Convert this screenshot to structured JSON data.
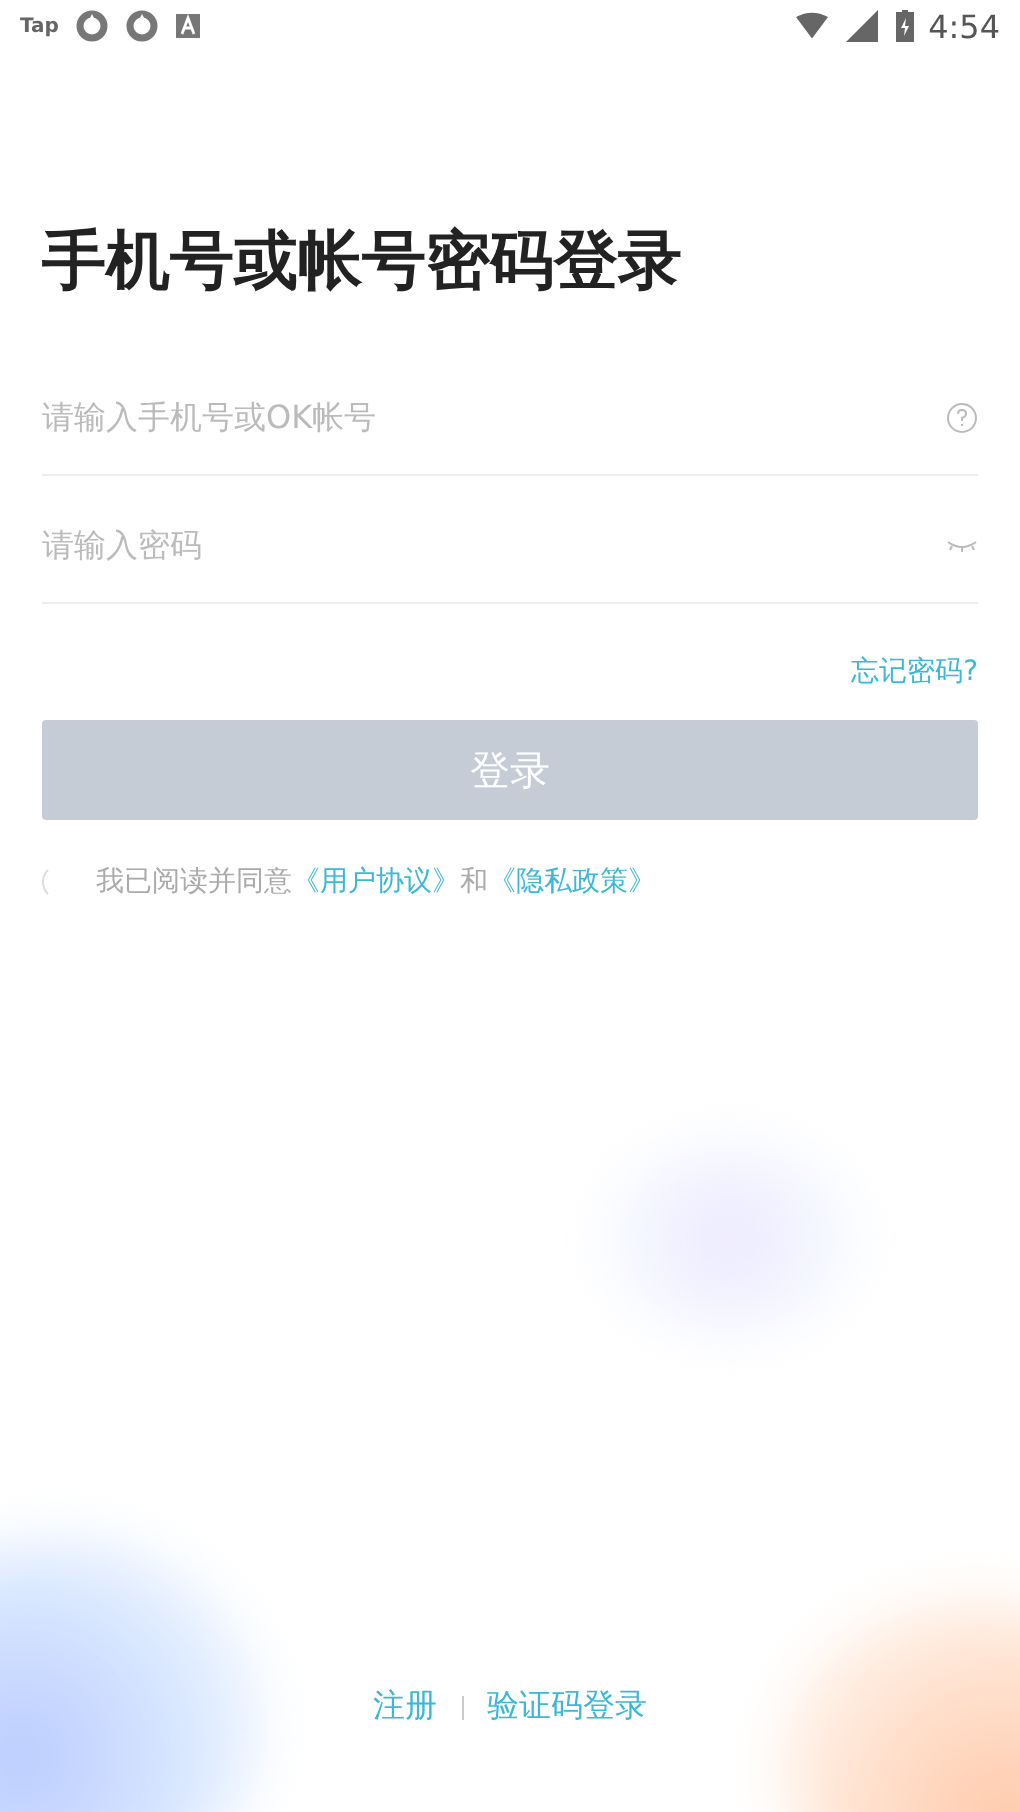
{
  "status_bar": {
    "app_label": "Tap",
    "time": "4:54"
  },
  "title": "手机号或帐号密码登录",
  "account_field": {
    "placeholder": "请输入手机号或OK帐号"
  },
  "password_field": {
    "placeholder": "请输入密码"
  },
  "forgot_link": "忘记密码?",
  "login_button": {
    "label": "登录",
    "disabled": true
  },
  "agreement": {
    "checked": false,
    "text": "我已阅读并同意",
    "link_1": "《用户协议》",
    "joiner": "和",
    "link_2": "《隐私政策》"
  },
  "footer": {
    "register": "注册",
    "sms_login": "验证码登录"
  }
}
